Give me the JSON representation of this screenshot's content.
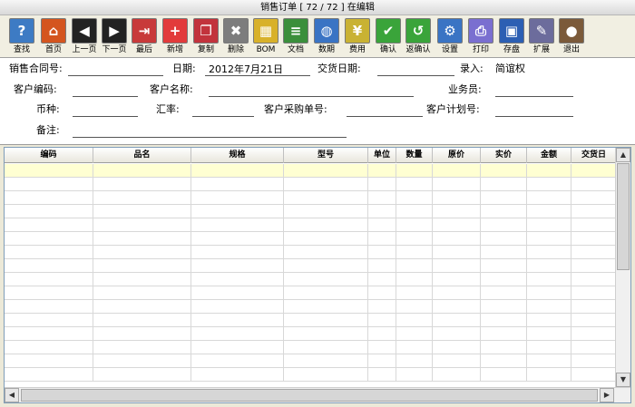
{
  "window": {
    "title": "销售订单 [ 72 / 72 ]  在编辑"
  },
  "toolbar": [
    {
      "label": "查找",
      "icon": "search-doc-icon",
      "color": "#3d7bc4",
      "glyph": "?"
    },
    {
      "label": "首页",
      "icon": "home-icon",
      "color": "#d4551f",
      "glyph": "⌂"
    },
    {
      "label": "上一页",
      "icon": "prev-page-icon",
      "color": "#222222",
      "glyph": "◀"
    },
    {
      "label": "下一页",
      "icon": "next-page-icon",
      "color": "#222222",
      "glyph": "▶"
    },
    {
      "label": "最后",
      "icon": "last-page-icon",
      "color": "#c83a3a",
      "glyph": "⇥"
    },
    {
      "label": "新增",
      "icon": "add-icon",
      "color": "#e23b3b",
      "glyph": "+"
    },
    {
      "label": "复制",
      "icon": "copy-icon",
      "color": "#c2333c",
      "glyph": "❐"
    },
    {
      "label": "删除",
      "icon": "delete-icon",
      "color": "#7d7d7d",
      "glyph": "✖"
    },
    {
      "label": "BOM",
      "icon": "bom-icon",
      "color": "#d8b12a",
      "glyph": "▦"
    },
    {
      "label": "文档",
      "icon": "document-icon",
      "color": "#3b8f3b",
      "glyph": "≡"
    },
    {
      "label": "数期",
      "icon": "globe-icon",
      "color": "#3a74c4",
      "glyph": "◍"
    },
    {
      "label": "费用",
      "icon": "expense-icon",
      "color": "#c9b233",
      "glyph": "¥"
    },
    {
      "label": "确认",
      "icon": "confirm-icon",
      "color": "#3aa43a",
      "glyph": "✔"
    },
    {
      "label": "返确认",
      "icon": "unconfirm-icon",
      "color": "#3aa43a",
      "glyph": "↺"
    },
    {
      "label": "设置",
      "icon": "settings-icon",
      "color": "#3a74c4",
      "glyph": "⚙"
    },
    {
      "label": "打印",
      "icon": "print-icon",
      "color": "#7a6fd0",
      "glyph": "⎙"
    },
    {
      "label": "存盘",
      "icon": "save-icon",
      "color": "#2c5fb3",
      "glyph": "▣"
    },
    {
      "label": "扩展",
      "icon": "extend-icon",
      "color": "#6c6c9c",
      "glyph": "✎"
    },
    {
      "label": "退出",
      "icon": "exit-icon",
      "color": "#7b5a3a",
      "glyph": "●"
    }
  ],
  "form": {
    "contract_no_label": "销售合同号:",
    "contract_no": "",
    "date_label": "日期:",
    "date": "2012年7月21日",
    "delivery_date_label": "交货日期:",
    "delivery_date": "",
    "entered_by_label": "录入:",
    "entered_by": "简谊权",
    "customer_code_label": "客户编码:",
    "customer_code": "",
    "customer_name_label": "客户名称:",
    "customer_name": "",
    "salesperson_label": "业务员:",
    "salesperson": "",
    "currency_label": "币种:",
    "currency": "",
    "exchange_rate_label": "汇率:",
    "exchange_rate": "",
    "customer_po_label": "客户采购单号:",
    "customer_po": "",
    "customer_plan_label": "客户计划号:",
    "customer_plan": "",
    "remarks_label": "备注:",
    "remarks": ""
  },
  "grid": {
    "columns": [
      "编码",
      "品名",
      "规格",
      "型号",
      "单位",
      "数量",
      "原价",
      "实价",
      "金额",
      "交货日"
    ],
    "rows": []
  },
  "colors": {
    "selected_row": "#ffffd2",
    "grid_line": "#d8d8d8"
  }
}
